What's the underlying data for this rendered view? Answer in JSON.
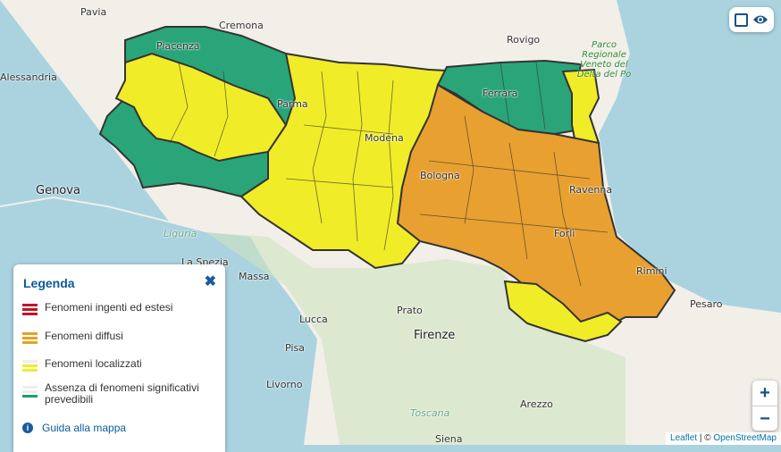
{
  "map": {
    "cities": [
      {
        "name": "Pavia"
      },
      {
        "name": "Cremona"
      },
      {
        "name": "Rovigo"
      },
      {
        "name": "Alessandria"
      },
      {
        "name": "Piacenza"
      },
      {
        "name": "Parma"
      },
      {
        "name": "Modena"
      },
      {
        "name": "Ferrara"
      },
      {
        "name": "Bologna"
      },
      {
        "name": "Ravenna"
      },
      {
        "name": "Forlì"
      },
      {
        "name": "Rimini"
      },
      {
        "name": "Genova"
      },
      {
        "name": "Liguria"
      },
      {
        "name": "La Spezia"
      },
      {
        "name": "Massa"
      },
      {
        "name": "Lucca"
      },
      {
        "name": "Prato"
      },
      {
        "name": "Firenze"
      },
      {
        "name": "Pisa"
      },
      {
        "name": "Livorno"
      },
      {
        "name": "Toscana"
      },
      {
        "name": "Arezzo"
      },
      {
        "name": "Siena"
      },
      {
        "name": "Pesaro"
      }
    ],
    "park_label": "Parco Regionale Veneto del Delta del Po",
    "colors": {
      "sea": "#aad3df",
      "land": "#f2efe9",
      "green": "#2aa57a",
      "yellow": "#f0ec28",
      "orange": "#e8a030",
      "border": "#333333"
    }
  },
  "legend": {
    "title": "Legenda",
    "close_icon": "close-icon",
    "items": [
      {
        "label": "Fenomeni ingenti ed estesi",
        "color": "#c0142a"
      },
      {
        "label": "Fenomeni diffusi",
        "color": "#e8a020"
      },
      {
        "label": "Fenomeni localizzati",
        "color": "#f0ec28"
      },
      {
        "label": "Assenza di fenomeni significativi prevedibili",
        "color": "#1f9a73"
      }
    ],
    "guide_label": "Guida alla mappa"
  },
  "controls": {
    "zoom_in": "+",
    "zoom_out": "−"
  },
  "attribution": {
    "leaflet": "Leaflet",
    "sep": " | © ",
    "osm": "OpenStreetMap"
  }
}
